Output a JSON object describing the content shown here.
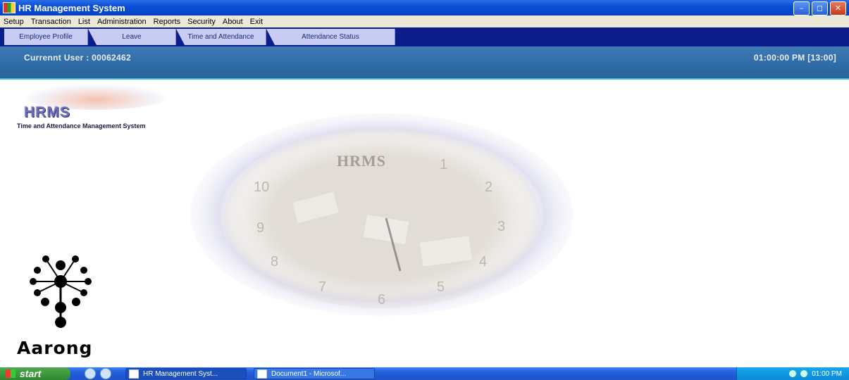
{
  "window": {
    "title": "HR Management System"
  },
  "menu": [
    "Setup",
    "Transaction",
    "List",
    "Administration",
    "Reports",
    "Security",
    "About",
    "Exit"
  ],
  "nav_tabs": [
    {
      "label": "Employee Profile"
    },
    {
      "label": "Leave"
    },
    {
      "label": "Time and Attendance"
    },
    {
      "label": "Attendance Status"
    }
  ],
  "header": {
    "user": "Currennt User : 00062462",
    "clock": "01:00:00 PM [13:00]"
  },
  "branding": {
    "hrms_badge": "HRMS",
    "tagline": "Time and Attendance Management System",
    "watermark": "HRMS",
    "aarong_text": "Aarong",
    "clock_numbers": [
      "10",
      "2",
      "3",
      "8",
      "7",
      "6",
      "5",
      "4",
      "1",
      "9"
    ]
  },
  "taskbar": {
    "start": "start",
    "tasks": [
      {
        "label": "HR Management Syst..."
      },
      {
        "label": "Document1 - Microsof..."
      }
    ],
    "time": "01:00 PM"
  },
  "colors": {
    "accent": "#0b1e8c",
    "header_bg": "#2f6ba6",
    "tab_bg": "#c8cbf2"
  }
}
